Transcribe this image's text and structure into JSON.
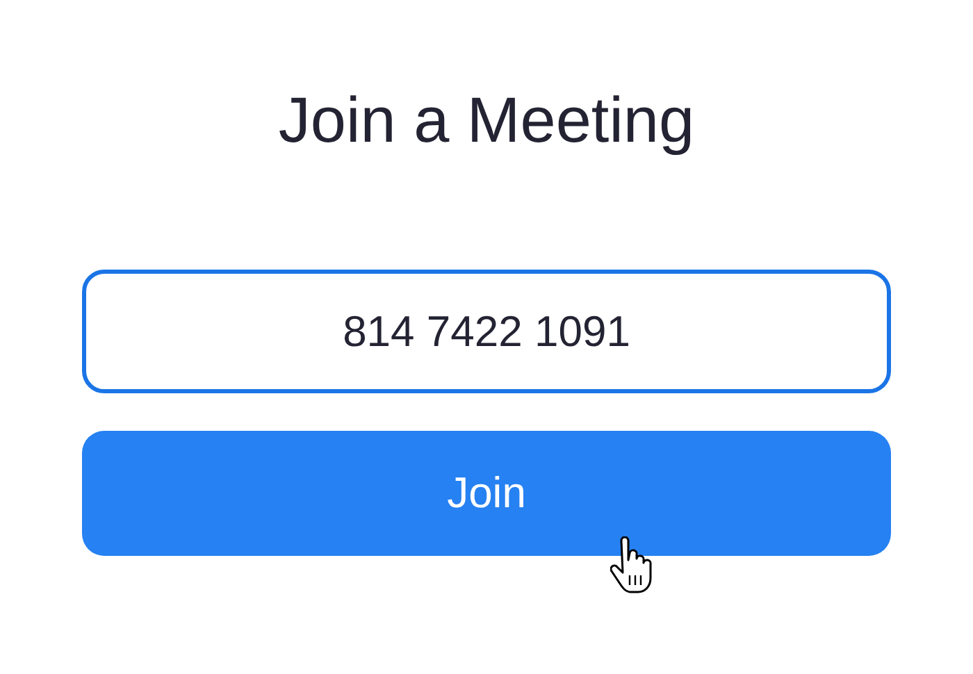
{
  "title": "Join a Meeting",
  "meeting_id": {
    "value": "814 7422 1091"
  },
  "join_button": {
    "label": "Join"
  }
}
